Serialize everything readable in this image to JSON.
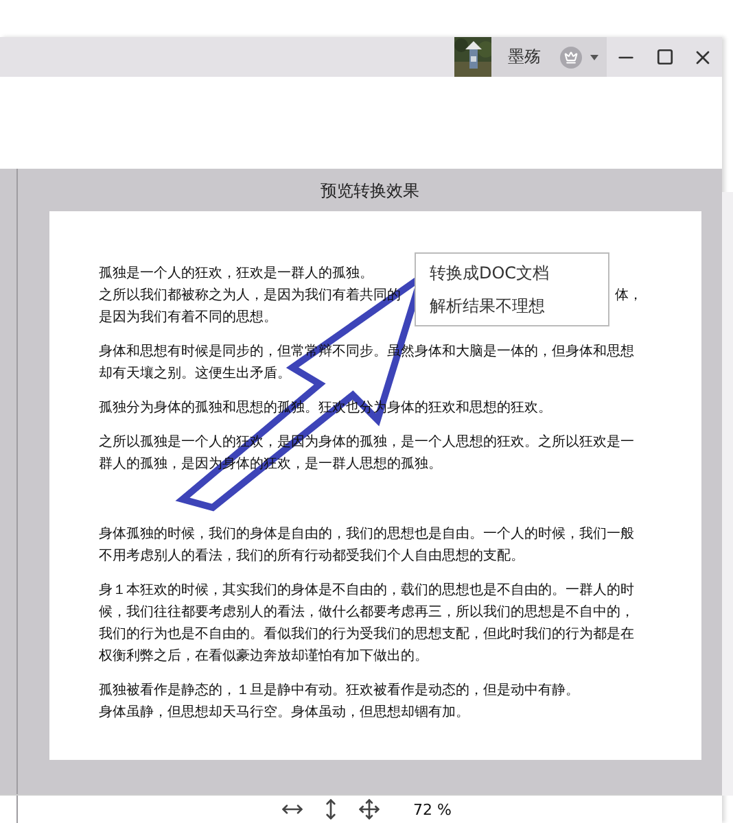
{
  "title_bar": {
    "user_name": "墨殇"
  },
  "preview": {
    "title": "预览转换效果",
    "parts": [
      {
        "groups": [
          [
            {
              "kind": "text",
              "text": "孤独是一个人的狂欢，狂欢是一群人的孤独。"
            },
            {
              "kind": "split",
              "before": "之所以我们都被称之为人，是因为我们有着共同的",
              "after": "体，"
            },
            {
              "kind": "text",
              "text": "是因为我们有着不同的思想。"
            }
          ],
          [
            {
              "kind": "text",
              "text": "身体和思想有时候是同步的，但常常辩不同步。虽然身体和大脑是一体的，但身体和思想却有天壤之别。这便生出矛盾。"
            }
          ],
          [
            {
              "kind": "text",
              "text": "孤独分为身体的孤独和思想的孤独。狂欢也分为身体的狂欢和思想的狂欢。"
            }
          ],
          [
            {
              "kind": "text",
              "text": "之所以孤独是一个人的狂欢，是因为身体的孤独，是一个人思想的狂欢。之所以狂欢是一群人的孤独，是因为身体的狂欢，是一群人思想的孤独。"
            }
          ]
        ]
      },
      {
        "groups": [
          [
            {
              "kind": "text",
              "text": "身体孤独的时候，我们的身体是自由的，我们的思想也是自由。一个人的时候，我们一般不用考虑别人的看法，我们的所有行动都受我们个人自由思想的支配。"
            }
          ],
          [
            {
              "kind": "text",
              "text": "身１本狂欢的时候，其实我们的身体是不自由的，载们的思想也是不自由的。一群人的时候，我们往往都要考虑别人的看法，做什么都要考虑再三，所以我们的思想是不自中的，我们的行为也是不自由的。看似我们的行为受我们的思想支配，但此时我们的行为都是在权衡利弊之后，在看似豪边奔放却谨怕有加下做出的。"
            }
          ],
          [
            {
              "kind": "text",
              "text": "孤独被看作是静态的，１旦是静中有动。狂欢被看作是动态的，但是动中有静。"
            },
            {
              "kind": "text",
              "text": "身体虽静，但思想却天马行空。身体虽动，但思想却锢有加。"
            }
          ]
        ]
      }
    ]
  },
  "context_menu": {
    "items": [
      "转换成DOC文档",
      "解析结果不理想"
    ]
  },
  "status_bar": {
    "zoom": "72 %"
  }
}
